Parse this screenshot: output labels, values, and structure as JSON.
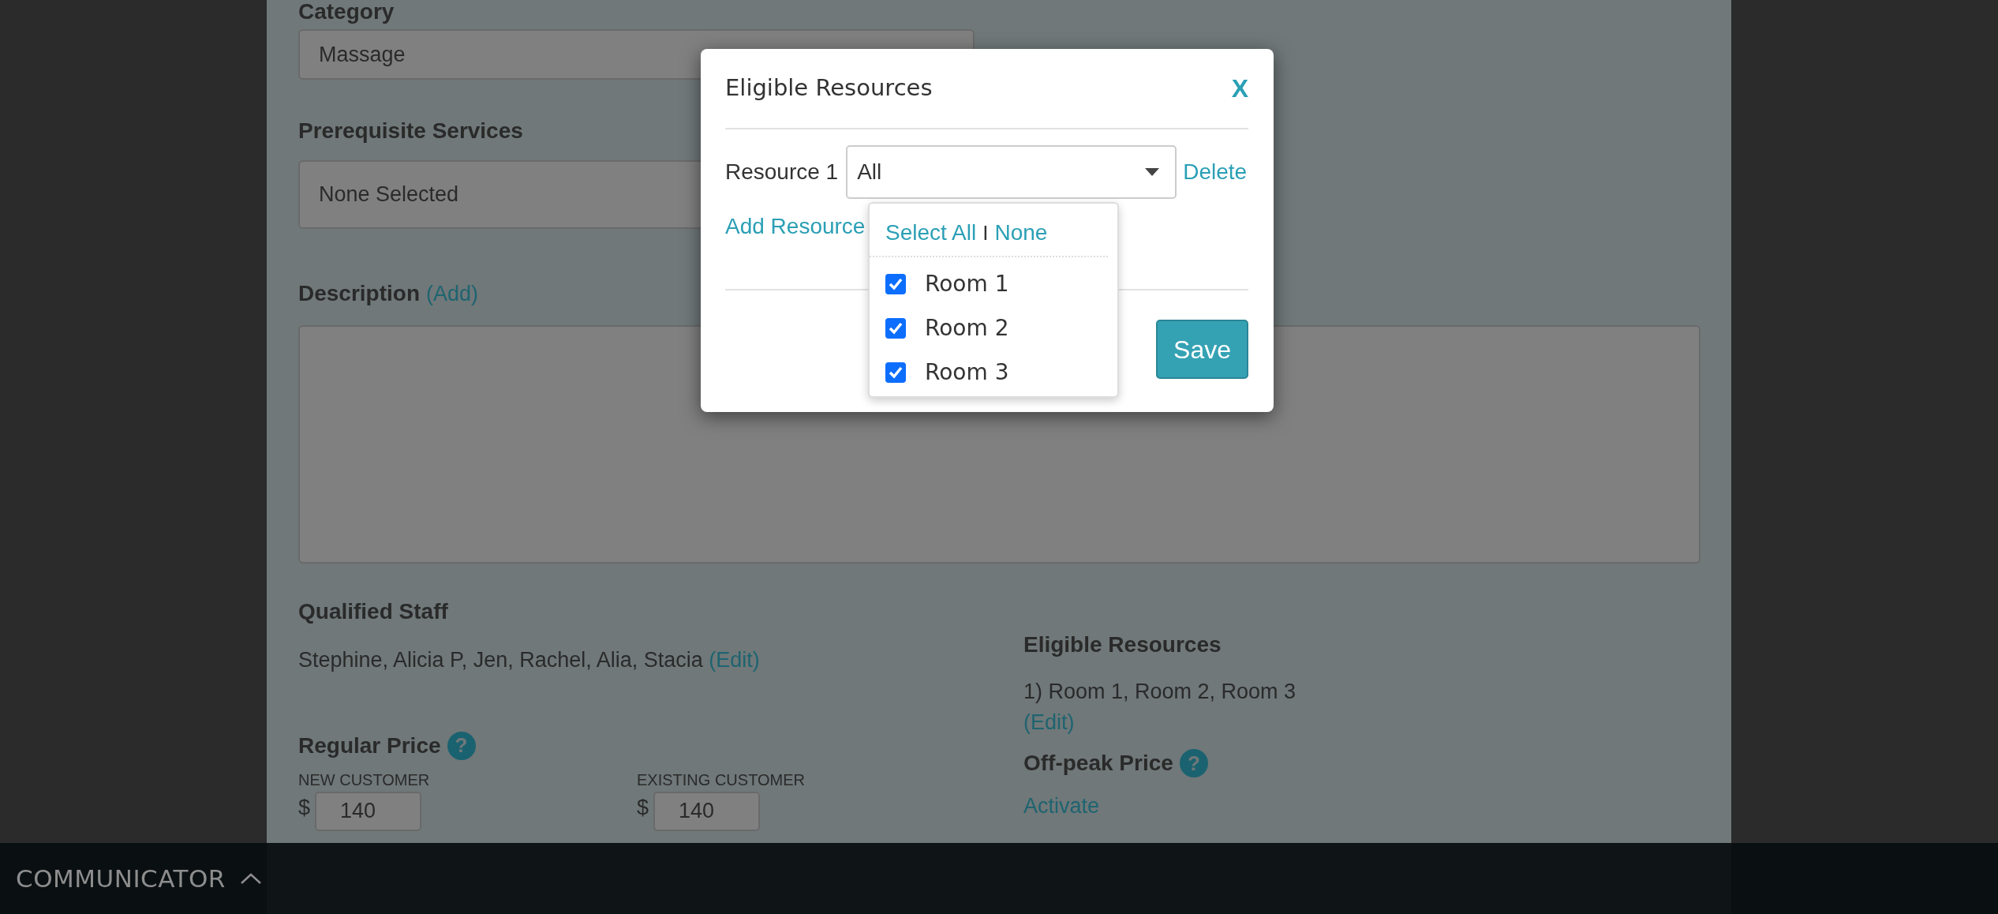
{
  "form": {
    "category": {
      "label": "Category",
      "value": "Massage"
    },
    "prerequisites": {
      "label": "Prerequisite Services",
      "value": "None Selected"
    },
    "description": {
      "label": "Description",
      "link": "(Add)"
    },
    "qualified_staff": {
      "label": "Qualified Staff",
      "text": "Stephine, Alicia P, Jen, Rachel, Alia, Stacia",
      "link": "(Edit)"
    },
    "eligible_resources": {
      "label": "Eligible Resources",
      "text": "1) Room 1, Room 2, Room 3",
      "link": "(Edit)"
    },
    "regular_price": {
      "label": "Regular Price",
      "help": "?",
      "fields": [
        {
          "label": "NEW CUSTOMER",
          "currency": "$",
          "value": "140"
        },
        {
          "label": "EXISTING CUSTOMER",
          "currency": "$",
          "value": "140"
        }
      ]
    },
    "off_peak_price": {
      "label": "Off-peak Price",
      "help": "?",
      "link": "Activate"
    }
  },
  "modal": {
    "title": "Eligible Resources",
    "close": "X",
    "resources": [
      {
        "label": "Resource 1",
        "value": "All",
        "action": "Delete"
      }
    ],
    "add_link": "Add Resource",
    "dropdown": {
      "select_all": "Select All",
      "separator": "I",
      "none": "None",
      "options": [
        {
          "label": "Room 1",
          "checked": true
        },
        {
          "label": "Room 2",
          "checked": true
        },
        {
          "label": "Room 3",
          "checked": true
        }
      ]
    },
    "save": "Save"
  },
  "communicator": {
    "label": "COMMUNICATOR"
  }
}
